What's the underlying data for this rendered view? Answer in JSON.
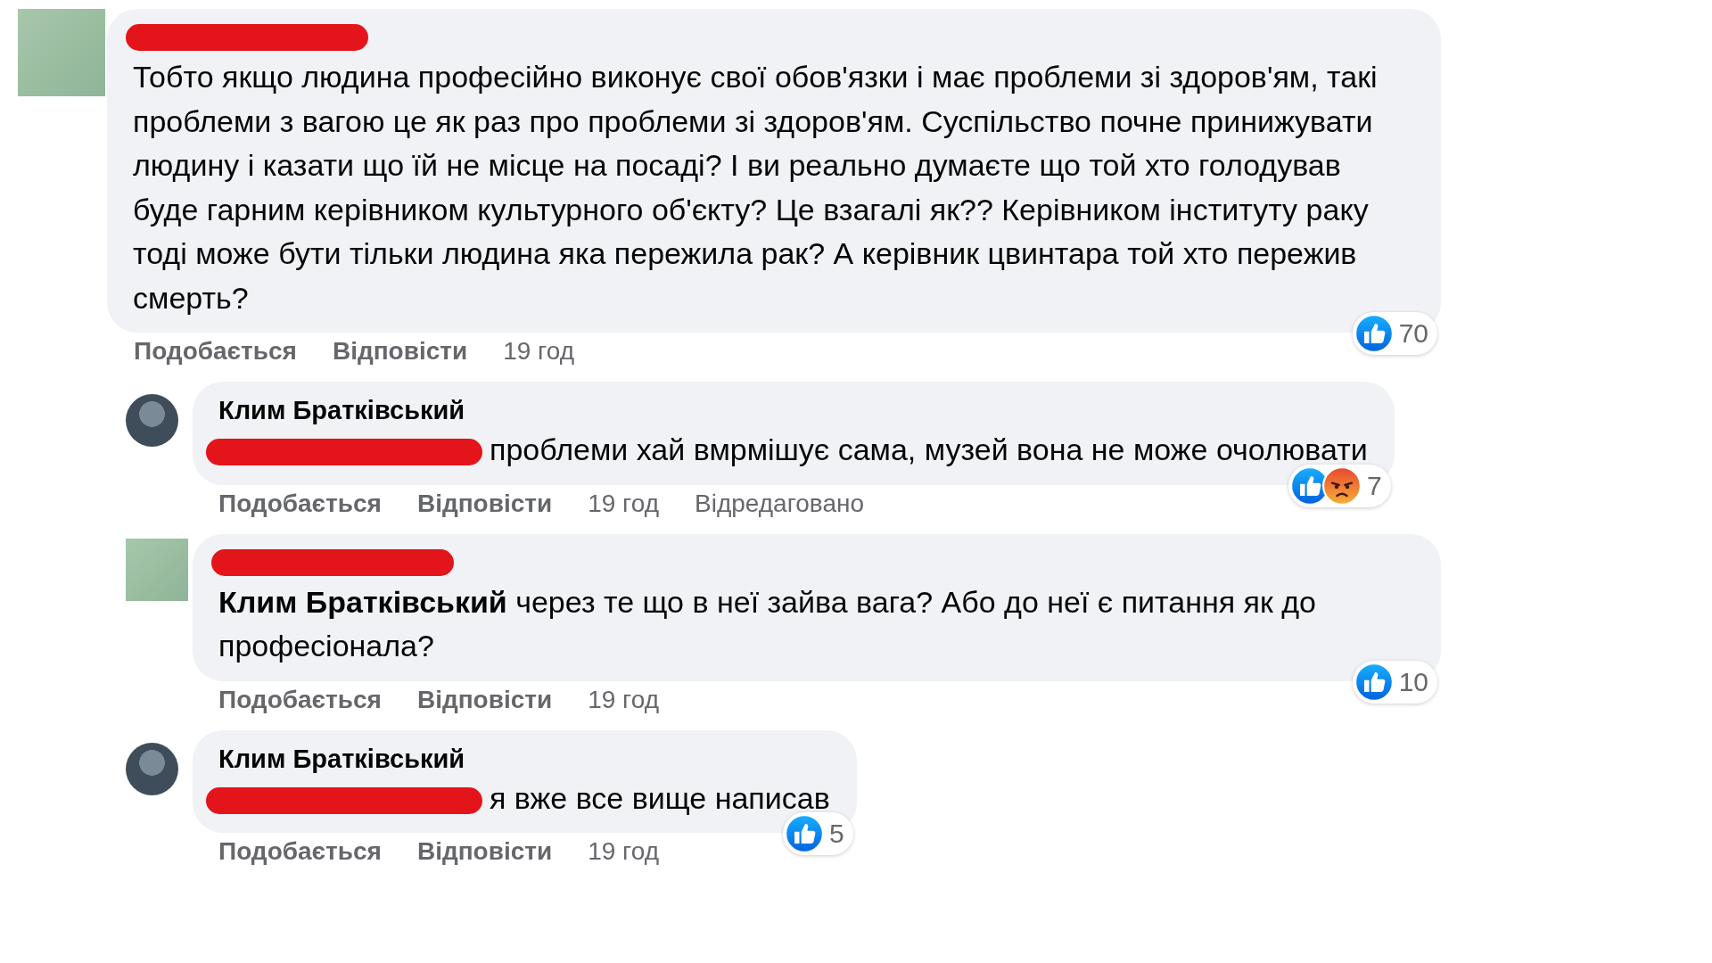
{
  "comments": [
    {
      "avatar": {
        "kind": "square"
      },
      "author": {
        "redacted": true
      },
      "text": {
        "mention_redacted": false,
        "body": "Тобто якщо людина професійно виконує свої обов'язки і має проблеми зі здоров'ям, такі проблеми з вагою це як раз про проблеми зі здоров'ям. Суспільство почне принижувати людину і казати що їй не місце на посаді? І ви реально думаєте що той хто голодував буде гарним керівником культурного об'єкту? Це взагалі як?? Керівником інституту раку тоді може бути тільки людина яка пережила рак? А керівник цвинтара той хто пережив смерть?"
      },
      "reactions": {
        "types": [
          {
            "kind": "like"
          }
        ],
        "count": "70"
      },
      "actions": [
        {
          "label": "Подобається",
          "kind": "link"
        },
        {
          "label": "Відповісти",
          "kind": "link"
        },
        {
          "label": "19 год",
          "kind": "time"
        }
      ],
      "replies": [
        {
          "avatar": {
            "kind": "round"
          },
          "author": {
            "redacted": false,
            "name": "Клим Братківський"
          },
          "text": {
            "mention_redacted": true,
            "body": "проблеми хай вмрмішує сама, музей вона не може очолювати"
          },
          "reactions": {
            "types": [
              {
                "kind": "like"
              },
              {
                "kind": "angry"
              }
            ],
            "count": "7"
          },
          "actions": [
            {
              "label": "Подобається",
              "kind": "link"
            },
            {
              "label": "Відповісти",
              "kind": "link"
            },
            {
              "label": "19 год",
              "kind": "time"
            },
            {
              "label": "Відредаговано",
              "kind": "note"
            }
          ]
        },
        {
          "avatar": {
            "kind": "square"
          },
          "author": {
            "redacted": true
          },
          "text": {
            "mention_redacted": false,
            "body": "**Клим Братківський** через те що в неї зайва вага? Або до неї є питання як до професіонала?"
          },
          "reactions": {
            "types": [
              {
                "kind": "like"
              }
            ],
            "count": "10"
          },
          "actions": [
            {
              "label": "Подобається",
              "kind": "link"
            },
            {
              "label": "Відповісти",
              "kind": "link"
            },
            {
              "label": "19 год",
              "kind": "time"
            }
          ]
        },
        {
          "avatar": {
            "kind": "round"
          },
          "author": {
            "redacted": false,
            "name": "Клим Братківський"
          },
          "text": {
            "mention_redacted": true,
            "body": "я вже все вище написав"
          },
          "reactions": {
            "types": [
              {
                "kind": "like"
              }
            ],
            "count": "5"
          },
          "actions": [
            {
              "label": "Подобається",
              "kind": "link"
            },
            {
              "label": "Відповісти",
              "kind": "link"
            },
            {
              "label": "19 год",
              "kind": "time"
            }
          ]
        }
      ]
    }
  ]
}
